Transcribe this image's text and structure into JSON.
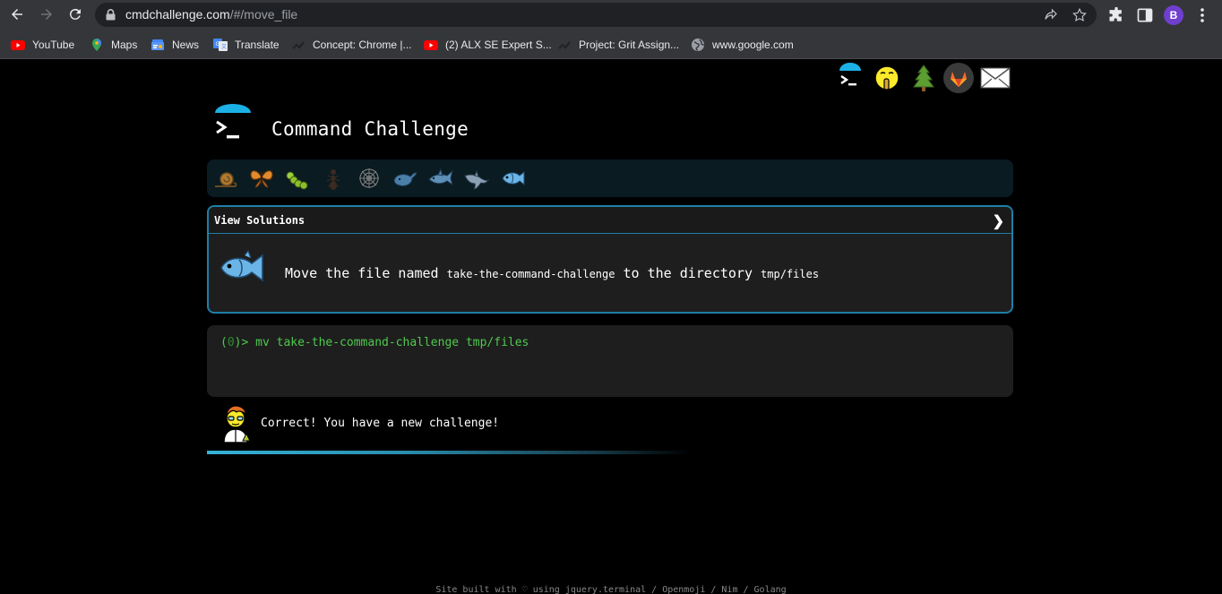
{
  "browser": {
    "url_host": "cmdchallenge.com",
    "url_path": "/#/move_file",
    "profile_initial": "B",
    "bookmarks": [
      {
        "label": "YouTube",
        "icon": "youtube-icon"
      },
      {
        "label": "Maps",
        "icon": "maps-pin-icon"
      },
      {
        "label": "News",
        "icon": "google-news-icon"
      },
      {
        "label": "Translate",
        "icon": "google-translate-icon"
      },
      {
        "label": "Concept: Chrome |...",
        "icon": "concept-page-icon"
      },
      {
        "label": "(2) ALX SE Expert S...",
        "icon": "youtube-icon"
      },
      {
        "label": "Project: Grit Assign...",
        "icon": "project-page-icon"
      },
      {
        "label": "www.google.com",
        "icon": "globe-icon"
      }
    ]
  },
  "page": {
    "title": "Command Challenge",
    "view_solutions_label": "View Solutions",
    "chevron_glyph": "❯",
    "challenge": {
      "prefix": "Move the file named ",
      "file": "take-the-command-challenge",
      "middle": " to the directory ",
      "dir": "tmp/files"
    },
    "terminal": {
      "prompt_open": "(",
      "exit_code": "0",
      "prompt_close": ")>",
      "command": "mv take-the-command-challenge tmp/files"
    },
    "result_message": "Correct! You have a new challenge!",
    "footer": "Site built with ♡ using jquery.terminal / Openmoji / Nim / Golang",
    "progress_fraction": 0.6,
    "level_icons": [
      "snail-icon",
      "butterfly-icon",
      "caterpillar-icon",
      "ant-icon",
      "web-icon",
      "whale-icon",
      "shark-icon",
      "dolphin-icon",
      "fish-icon"
    ],
    "social_icons": [
      "terminal-logo-icon",
      "shushing-face-icon",
      "tree-icon",
      "gitlab-icon",
      "envelope-icon"
    ]
  },
  "colors": {
    "accent": "#1e7fa6",
    "terminal_green": "#4ec94e",
    "progress": "#35b2d6"
  }
}
